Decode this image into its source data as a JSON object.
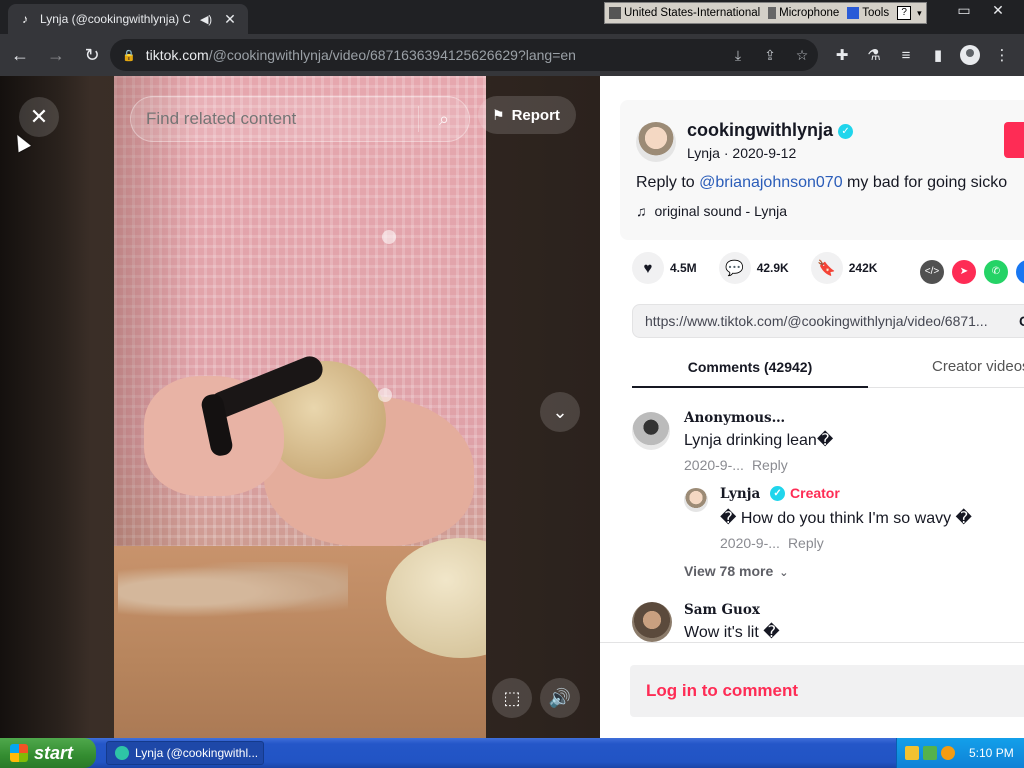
{
  "browser": {
    "tab": {
      "title": "Lynja (@cookingwithlynja) Offi",
      "favicon": "tiktok-icon"
    },
    "ime": {
      "language": "United States-International",
      "microphone": "Microphone",
      "tools": "Tools",
      "help": "?"
    },
    "window_controls": {
      "restore": "▭",
      "close": "✕"
    },
    "nav": {
      "back": "←",
      "forward": "→",
      "reload": "↻"
    },
    "url": {
      "host": "tiktok.com",
      "path": "/@cookingwithlynja/video/6871636394125626629?lang=en"
    }
  },
  "video": {
    "search_placeholder": "Find related content",
    "report_label": "Report",
    "close_symbol": "✕",
    "next_symbol": "⌄",
    "volume_symbol": "🔊",
    "pip_symbol": "⬚"
  },
  "post": {
    "author_handle": "cookingwithlynja",
    "author_name": "Lynja",
    "date": "2020-9-12",
    "description_prefix": "Reply to ",
    "description_mention": "@brianajohnson070",
    "description_rest": " my bad for going sicko",
    "music": "original sound - Lynja",
    "likes": "4.5M",
    "comments": "42.9K",
    "bookmarks": "242K",
    "share_link": "https://www.tiktok.com/@cookingwithlynja/video/6871...",
    "share_link_copy": "C"
  },
  "tabs": {
    "comments": "Comments (42942)",
    "creator_videos": "Creator videos"
  },
  "comments": [
    {
      "user": "Anonymous…",
      "text": "Lynja drinking lean�",
      "date": "2020-9-...",
      "reply": "Reply"
    },
    {
      "user": "Lynja",
      "creator_tag": "Creator",
      "text": "� How do you think I'm so wavy �",
      "date": "2020-9-...",
      "reply": "Reply"
    },
    {
      "user": "Sam Guox",
      "text": "Wow it's lit �"
    }
  ],
  "view_more": "View 78 more",
  "login_prompt": "Log in to comment",
  "taskbar": {
    "start": "start",
    "task_title": "Lynja (@cookingwithl...",
    "clock": "5:10 PM"
  },
  "colors": {
    "tiktok_red": "#fe2c55",
    "verified": "#20d5ec",
    "mention": "#2b5db9"
  }
}
